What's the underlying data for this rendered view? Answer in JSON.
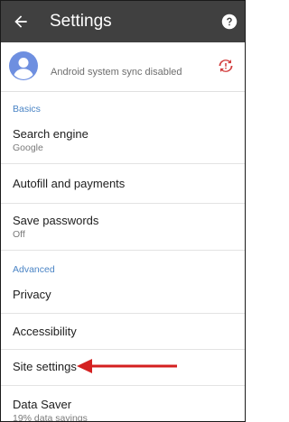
{
  "header": {
    "title": "Settings",
    "back_icon": "arrow-back-icon",
    "help_icon": "help-circle-icon"
  },
  "account": {
    "sync_status": "Android system sync disabled",
    "avatar_icon": "account-avatar-icon",
    "sync_icon": "sync-error-icon"
  },
  "sections": {
    "basics": "Basics",
    "advanced": "Advanced"
  },
  "items": {
    "search_engine": {
      "label": "Search engine",
      "sub": "Google"
    },
    "autofill": {
      "label": "Autofill and payments"
    },
    "save_passwords": {
      "label": "Save passwords",
      "sub": "Off"
    },
    "privacy": {
      "label": "Privacy"
    },
    "accessibility": {
      "label": "Accessibility"
    },
    "site_settings": {
      "label": "Site settings"
    },
    "data_saver": {
      "label": "Data Saver",
      "sub": "19% data savings"
    }
  },
  "colors": {
    "appbar": "#404040",
    "section_header": "#4a84c5",
    "annotation_arrow": "#d42020",
    "sync_error": "#d13b3b"
  }
}
